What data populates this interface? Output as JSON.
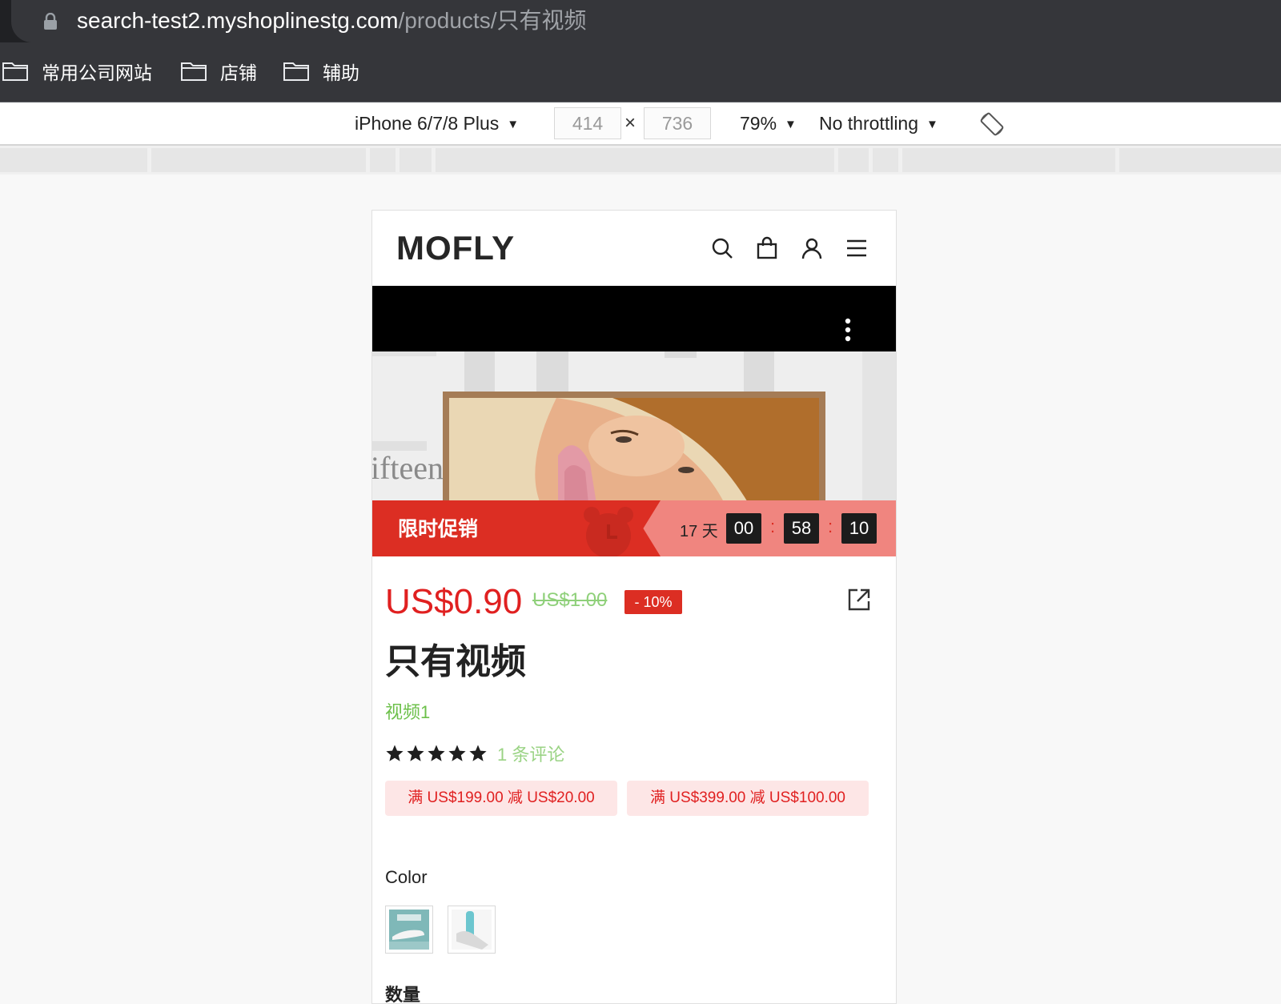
{
  "browser": {
    "url_domain": "search-test2.myshoplinestg.com",
    "url_path": "/products/只有视频",
    "bookmarks": [
      {
        "label": "常用公司网站"
      },
      {
        "label": "店铺"
      },
      {
        "label": "辅助"
      }
    ]
  },
  "devtools": {
    "device": "iPhone 6/7/8 Plus",
    "width": "414",
    "height": "736",
    "zoom": "79%",
    "throttling": "No throttling",
    "caret": "▼",
    "times": "×"
  },
  "store": {
    "logo": "MOFLY",
    "hero_text": "ifteen",
    "promo": {
      "title": "限时促销",
      "days": "17 天",
      "hours": "00",
      "minutes": "58",
      "seconds": "10",
      "separator": ":"
    },
    "price": "US$0.90",
    "original_price": "US$1.00",
    "discount": "- 10%",
    "title": "只有视频",
    "tag": "视频1",
    "rating_stars": 5,
    "reviews": "1 条评论",
    "coupons": [
      {
        "text": "满 US$199.00 减 US$20.00"
      },
      {
        "text": "满 US$399.00 减 US$100.00"
      }
    ],
    "color_label": "Color",
    "quantity_label": "数量"
  },
  "colors": {
    "accent_red": "#dc2e23",
    "price_red": "#e02020",
    "tag_green": "#6cc04a"
  }
}
